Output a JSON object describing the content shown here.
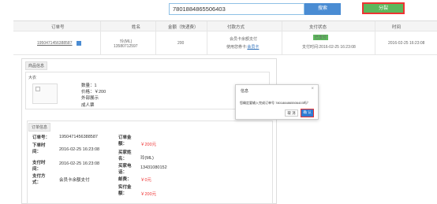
{
  "search": {
    "value": "7801884865506403",
    "button": "搜索"
  },
  "split_button": "分裂",
  "grid": {
    "headers": [
      "订单号",
      "姓名",
      "金额（快递费）",
      "付款方式",
      "支付状态",
      "时间"
    ],
    "row": {
      "order_no": "1950471456388587",
      "name": "玲(ML)",
      "phone": "13580712597",
      "amount": "200",
      "payment_line1": "会员卡余额支付",
      "payment_line2": "使用您券卡:",
      "payment_link": "会员卡",
      "status": "已支付",
      "paid_time": "支付时间:2016-02-25 16:23:08",
      "time": "2016-02-25 16:23:08"
    }
  },
  "goods": {
    "tab": "商品信息",
    "category": "大衣",
    "qty": "数量：1",
    "price": "价格：￥200",
    "ext": "外部展示",
    "adult": "成人票"
  },
  "order": {
    "tab": "订单信息",
    "order_no_label": "订单号：",
    "order_no": "1950471456388587",
    "order_time_label": "下单时间：",
    "order_time": "2016-02-25 16:23:08",
    "pay_time_label": "支付时间：",
    "pay_time": "2016-02-25 16:23:08",
    "pay_method_label": "支付方式：",
    "pay_method": "会员卡余额支付",
    "order_amount_label": "订单金额：",
    "order_amount": "￥200元",
    "buyer_label": "买家姓名：",
    "buyer": "玲(ML)",
    "buyer_phone_label": "买家电话：",
    "buyer_phone": "13431080152",
    "shipping_label": "邮费：",
    "shipping": "￥0元",
    "actual_label": "实付金额：",
    "actual": "￥200元"
  },
  "dialog": {
    "title": "信息",
    "close": "×",
    "message": "您确定要输入完成订单号 7801884865506403吗？",
    "cancel": "取 消",
    "ok": "确 认"
  }
}
